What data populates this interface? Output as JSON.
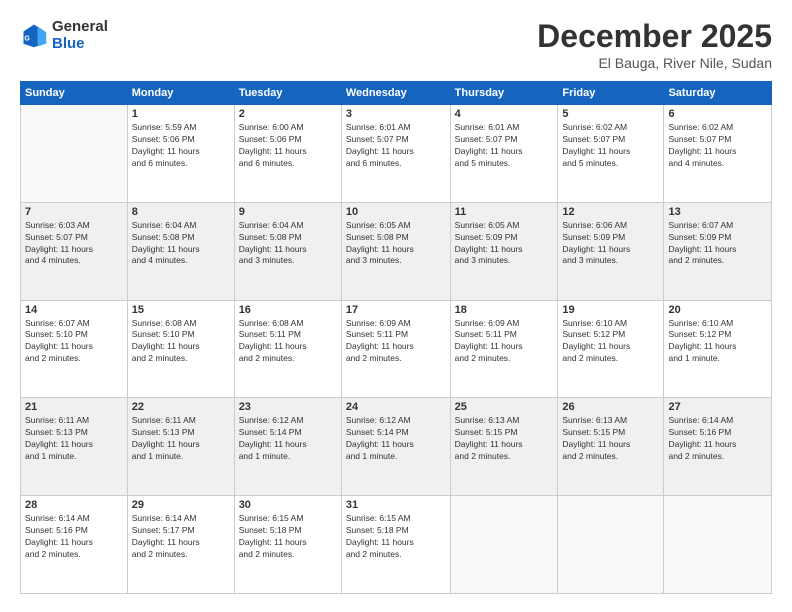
{
  "logo": {
    "line1": "General",
    "line2": "Blue"
  },
  "title": "December 2025",
  "location": "El Bauga, River Nile, Sudan",
  "weekdays": [
    "Sunday",
    "Monday",
    "Tuesday",
    "Wednesday",
    "Thursday",
    "Friday",
    "Saturday"
  ],
  "weeks": [
    [
      {
        "day": "",
        "info": ""
      },
      {
        "day": "1",
        "info": "Sunrise: 5:59 AM\nSunset: 5:06 PM\nDaylight: 11 hours\nand 6 minutes."
      },
      {
        "day": "2",
        "info": "Sunrise: 6:00 AM\nSunset: 5:06 PM\nDaylight: 11 hours\nand 6 minutes."
      },
      {
        "day": "3",
        "info": "Sunrise: 6:01 AM\nSunset: 5:07 PM\nDaylight: 11 hours\nand 6 minutes."
      },
      {
        "day": "4",
        "info": "Sunrise: 6:01 AM\nSunset: 5:07 PM\nDaylight: 11 hours\nand 5 minutes."
      },
      {
        "day": "5",
        "info": "Sunrise: 6:02 AM\nSunset: 5:07 PM\nDaylight: 11 hours\nand 5 minutes."
      },
      {
        "day": "6",
        "info": "Sunrise: 6:02 AM\nSunset: 5:07 PM\nDaylight: 11 hours\nand 4 minutes."
      }
    ],
    [
      {
        "day": "7",
        "info": "Sunrise: 6:03 AM\nSunset: 5:07 PM\nDaylight: 11 hours\nand 4 minutes."
      },
      {
        "day": "8",
        "info": "Sunrise: 6:04 AM\nSunset: 5:08 PM\nDaylight: 11 hours\nand 4 minutes."
      },
      {
        "day": "9",
        "info": "Sunrise: 6:04 AM\nSunset: 5:08 PM\nDaylight: 11 hours\nand 3 minutes."
      },
      {
        "day": "10",
        "info": "Sunrise: 6:05 AM\nSunset: 5:08 PM\nDaylight: 11 hours\nand 3 minutes."
      },
      {
        "day": "11",
        "info": "Sunrise: 6:05 AM\nSunset: 5:09 PM\nDaylight: 11 hours\nand 3 minutes."
      },
      {
        "day": "12",
        "info": "Sunrise: 6:06 AM\nSunset: 5:09 PM\nDaylight: 11 hours\nand 3 minutes."
      },
      {
        "day": "13",
        "info": "Sunrise: 6:07 AM\nSunset: 5:09 PM\nDaylight: 11 hours\nand 2 minutes."
      }
    ],
    [
      {
        "day": "14",
        "info": "Sunrise: 6:07 AM\nSunset: 5:10 PM\nDaylight: 11 hours\nand 2 minutes."
      },
      {
        "day": "15",
        "info": "Sunrise: 6:08 AM\nSunset: 5:10 PM\nDaylight: 11 hours\nand 2 minutes."
      },
      {
        "day": "16",
        "info": "Sunrise: 6:08 AM\nSunset: 5:11 PM\nDaylight: 11 hours\nand 2 minutes."
      },
      {
        "day": "17",
        "info": "Sunrise: 6:09 AM\nSunset: 5:11 PM\nDaylight: 11 hours\nand 2 minutes."
      },
      {
        "day": "18",
        "info": "Sunrise: 6:09 AM\nSunset: 5:11 PM\nDaylight: 11 hours\nand 2 minutes."
      },
      {
        "day": "19",
        "info": "Sunrise: 6:10 AM\nSunset: 5:12 PM\nDaylight: 11 hours\nand 2 minutes."
      },
      {
        "day": "20",
        "info": "Sunrise: 6:10 AM\nSunset: 5:12 PM\nDaylight: 11 hours\nand 1 minute."
      }
    ],
    [
      {
        "day": "21",
        "info": "Sunrise: 6:11 AM\nSunset: 5:13 PM\nDaylight: 11 hours\nand 1 minute."
      },
      {
        "day": "22",
        "info": "Sunrise: 6:11 AM\nSunset: 5:13 PM\nDaylight: 11 hours\nand 1 minute."
      },
      {
        "day": "23",
        "info": "Sunrise: 6:12 AM\nSunset: 5:14 PM\nDaylight: 11 hours\nand 1 minute."
      },
      {
        "day": "24",
        "info": "Sunrise: 6:12 AM\nSunset: 5:14 PM\nDaylight: 11 hours\nand 1 minute."
      },
      {
        "day": "25",
        "info": "Sunrise: 6:13 AM\nSunset: 5:15 PM\nDaylight: 11 hours\nand 2 minutes."
      },
      {
        "day": "26",
        "info": "Sunrise: 6:13 AM\nSunset: 5:15 PM\nDaylight: 11 hours\nand 2 minutes."
      },
      {
        "day": "27",
        "info": "Sunrise: 6:14 AM\nSunset: 5:16 PM\nDaylight: 11 hours\nand 2 minutes."
      }
    ],
    [
      {
        "day": "28",
        "info": "Sunrise: 6:14 AM\nSunset: 5:16 PM\nDaylight: 11 hours\nand 2 minutes."
      },
      {
        "day": "29",
        "info": "Sunrise: 6:14 AM\nSunset: 5:17 PM\nDaylight: 11 hours\nand 2 minutes."
      },
      {
        "day": "30",
        "info": "Sunrise: 6:15 AM\nSunset: 5:18 PM\nDaylight: 11 hours\nand 2 minutes."
      },
      {
        "day": "31",
        "info": "Sunrise: 6:15 AM\nSunset: 5:18 PM\nDaylight: 11 hours\nand 2 minutes."
      },
      {
        "day": "",
        "info": ""
      },
      {
        "day": "",
        "info": ""
      },
      {
        "day": "",
        "info": ""
      }
    ]
  ]
}
